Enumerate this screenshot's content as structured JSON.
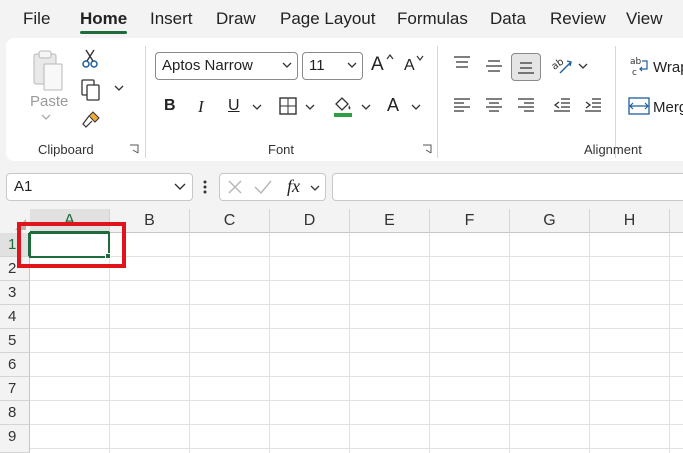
{
  "menu": {
    "file": "File",
    "home": "Home",
    "insert": "Insert",
    "draw": "Draw",
    "page_layout": "Page Layout",
    "formulas": "Formulas",
    "data": "Data",
    "review": "Review",
    "view": "View"
  },
  "clipboard": {
    "paste": "Paste",
    "group_label": "Clipboard"
  },
  "font": {
    "family": "Aptos Narrow",
    "size": "11",
    "bold": "B",
    "italic": "I",
    "underline": "U",
    "font_color_glyph": "A",
    "grow_glyph": "A",
    "shrink_glyph": "A",
    "group_label": "Font",
    "fill_color": "#2ea043"
  },
  "alignment": {
    "wrap": "Wrap",
    "merge": "Merg",
    "orientation_glyph": "ab",
    "wrap_glyph": "ab c",
    "group_label": "Alignment"
  },
  "formula_bar": {
    "name_box": "A1",
    "fx": "fx"
  },
  "grid": {
    "columns": [
      "A",
      "B",
      "C",
      "D",
      "E",
      "F",
      "G",
      "H"
    ],
    "rows": [
      "1",
      "2",
      "3",
      "4",
      "5",
      "6",
      "7",
      "8",
      "9"
    ],
    "selected_cell": "A1"
  },
  "colors": {
    "accent": "#1e6b3c",
    "highlight": "#e0151b"
  }
}
